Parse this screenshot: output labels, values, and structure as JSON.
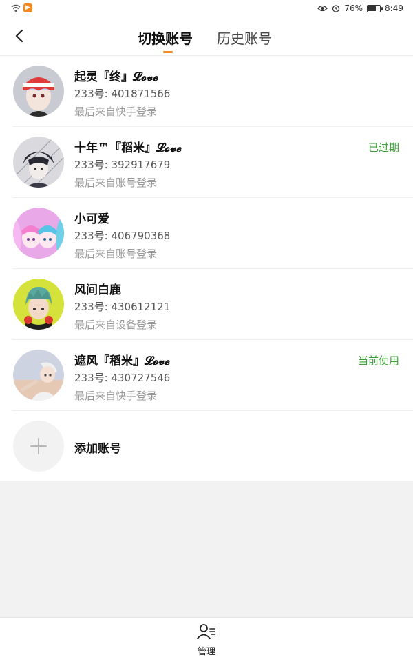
{
  "status_bar": {
    "battery": "76%",
    "time": "8:49",
    "icons": [
      "wifi-icon",
      "app-notification-icon",
      "eye-icon",
      "alarm-icon",
      "battery-icon"
    ]
  },
  "header": {
    "tabs": [
      {
        "label": "切换账号",
        "active": true
      },
      {
        "label": "历史账号",
        "active": false
      }
    ],
    "accent_color": "#f28a24"
  },
  "accounts": [
    {
      "name": "起灵『终』𝓛𝓸𝓿𝓮",
      "id_label": "233号: 401871566",
      "login": "最后来自快手登录",
      "status": ""
    },
    {
      "name": "十年™『稻米』𝓛𝓸𝓿𝓮",
      "id_label": "233号: 392917679",
      "login": "最后来自账号登录",
      "status": "已过期"
    },
    {
      "name": "小可爱",
      "id_label": "233号: 406790368",
      "login": "最后来自账号登录",
      "status": ""
    },
    {
      "name": "风间白鹿",
      "id_label": "233号: 430612121",
      "login": "最后来自设备登录",
      "status": ""
    },
    {
      "name": "遮风『稻米』𝓛𝓸𝓿𝓮",
      "id_label": "233号: 430727546",
      "login": "最后来自快手登录",
      "status": "当前使用"
    }
  ],
  "add_account": {
    "label": "添加账号"
  },
  "bottom": {
    "manage_label": "管理"
  },
  "colors": {
    "status_green": "#3f9e3a",
    "accent": "#f28a24"
  }
}
